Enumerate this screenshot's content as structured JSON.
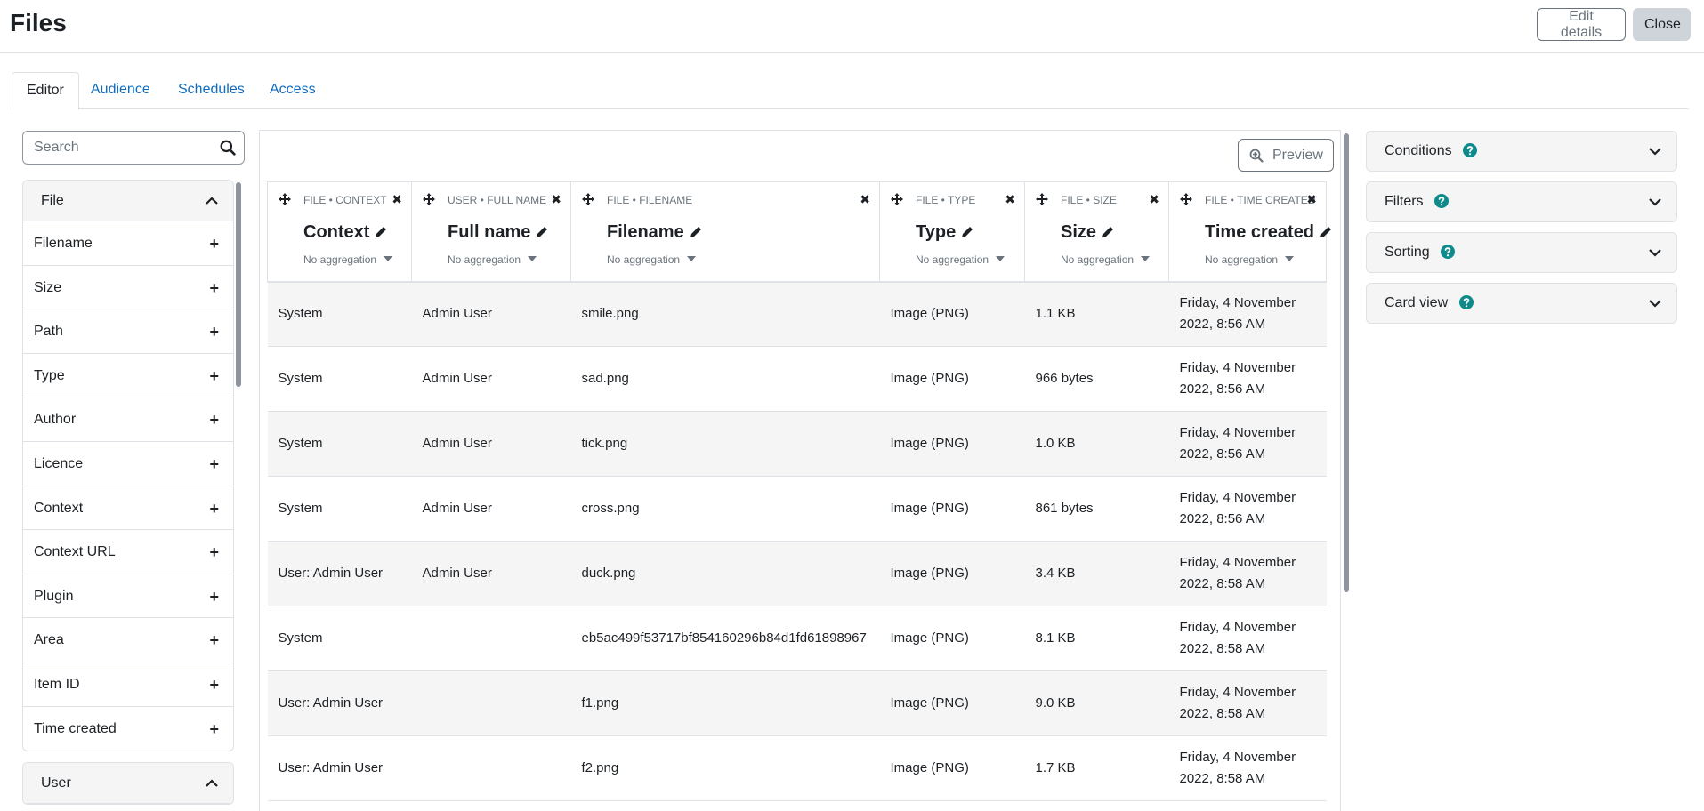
{
  "header": {
    "title": "Files",
    "edit_label": "Edit details",
    "close_label": "Close"
  },
  "tabs": [
    "Editor",
    "Audience",
    "Schedules",
    "Access"
  ],
  "search": {
    "placeholder": "Search"
  },
  "sidebar": {
    "file_group": {
      "title": "File",
      "items": [
        "Filename",
        "Size",
        "Path",
        "Type",
        "Author",
        "Licence",
        "Context",
        "Context URL",
        "Plugin",
        "Area",
        "Item ID",
        "Time created"
      ]
    },
    "user_group": {
      "title": "User"
    }
  },
  "preview_label": "Preview",
  "columns": [
    {
      "path": "FILE • CONTEXT",
      "name": "Context",
      "agg": "No aggregation"
    },
    {
      "path": "USER • FULL NAME",
      "name": "Full name",
      "agg": "No aggregation"
    },
    {
      "path": "FILE • FILENAME",
      "name": "Filename",
      "agg": "No aggregation"
    },
    {
      "path": "FILE • TYPE",
      "name": "Type",
      "agg": "No aggregation"
    },
    {
      "path": "FILE • SIZE",
      "name": "Size",
      "agg": "No aggregation"
    },
    {
      "path": "FILE • TIME CREATED",
      "name": "Time created",
      "agg": "No aggregation"
    }
  ],
  "rows": [
    [
      "System",
      "Admin User",
      "smile.png",
      "Image (PNG)",
      "1.1 KB",
      "Friday, 4 November 2022, 8:56 AM"
    ],
    [
      "System",
      "Admin User",
      "sad.png",
      "Image (PNG)",
      "966 bytes",
      "Friday, 4 November 2022, 8:56 AM"
    ],
    [
      "System",
      "Admin User",
      "tick.png",
      "Image (PNG)",
      "1.0 KB",
      "Friday, 4 November 2022, 8:56 AM"
    ],
    [
      "System",
      "Admin User",
      "cross.png",
      "Image (PNG)",
      "861 bytes",
      "Friday, 4 November 2022, 8:56 AM"
    ],
    [
      "User: Admin User",
      "Admin User",
      "duck.png",
      "Image (PNG)",
      "3.4 KB",
      "Friday, 4 November 2022, 8:58 AM"
    ],
    [
      "System",
      "",
      "eb5ac499f53717bf854160296b84d1fd61898967",
      "Image (PNG)",
      "8.1 KB",
      "Friday, 4 November 2022, 8:58 AM"
    ],
    [
      "User: Admin User",
      "",
      "f1.png",
      "Image (PNG)",
      "9.0 KB",
      "Friday, 4 November 2022, 8:58 AM"
    ],
    [
      "User: Admin User",
      "",
      "f2.png",
      "Image (PNG)",
      "1.7 KB",
      "Friday, 4 November 2022, 8:58 AM"
    ]
  ],
  "right_panels": [
    "Conditions",
    "Filters",
    "Sorting",
    "Card view"
  ],
  "colors": {
    "link": "#0f6cbf",
    "help_icon": "#0f8a8a",
    "border": "#dee2e6",
    "stripe": "#f5f5f5"
  }
}
